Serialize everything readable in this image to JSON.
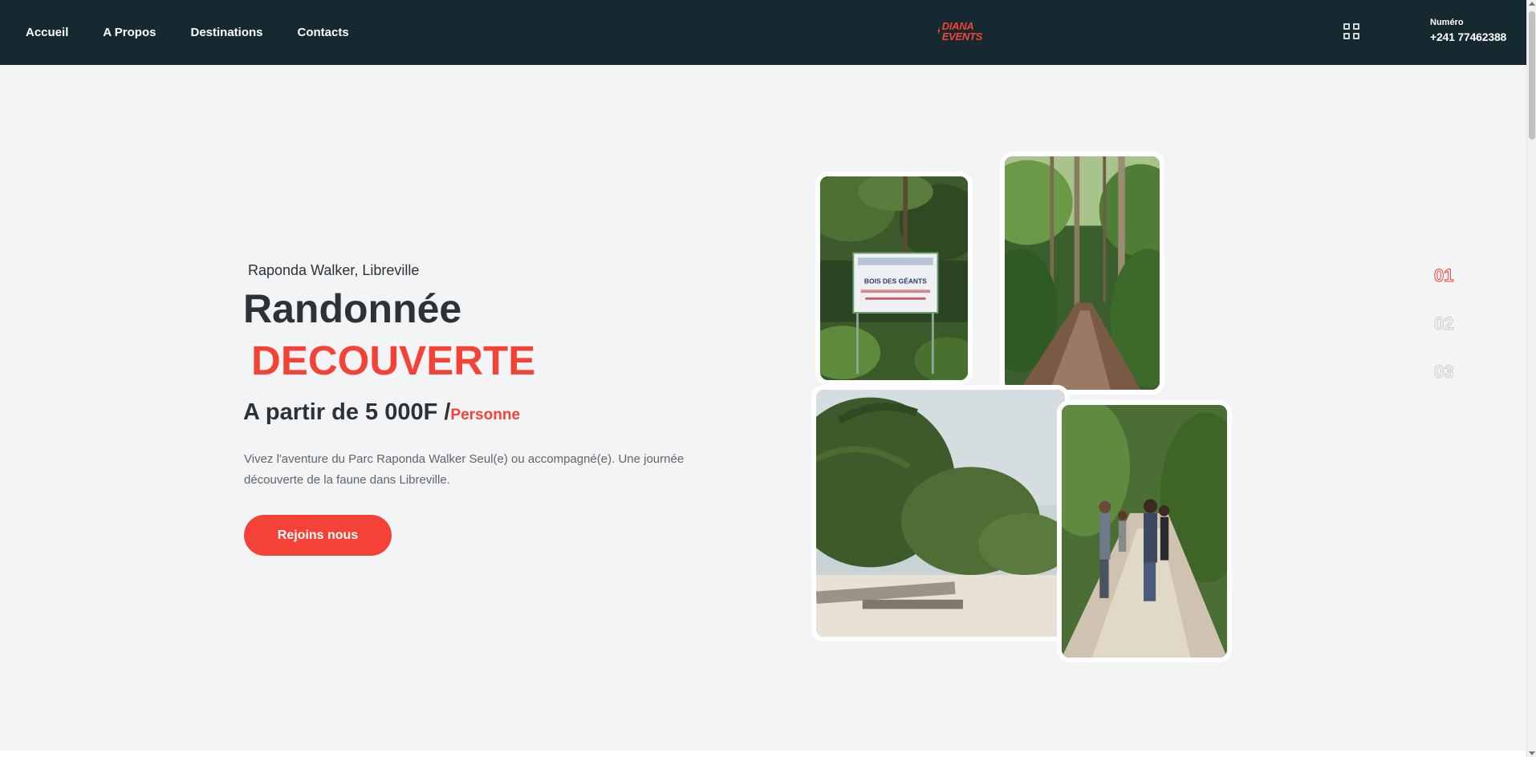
{
  "nav": {
    "items": [
      {
        "label": "Accueil"
      },
      {
        "label": "A Propos"
      },
      {
        "label": "Destinations"
      },
      {
        "label": "Contacts"
      }
    ]
  },
  "logo": {
    "line1": "DIANA",
    "line2": "EVENTS",
    "icon": "lightning-bolt-icon"
  },
  "header_right": {
    "menu_icon": "grid-icon",
    "contact_label": "Numéro",
    "contact_number": "+241 77462388"
  },
  "hero": {
    "location": "Raponda Walker, Libreville",
    "title_line1": "Randonnée",
    "title_line2": "DECOUVERTE",
    "price_text": "A partir de 5 000F /",
    "price_unit": "Personne",
    "description": "Vivez l'aventure du Parc Raponda Walker Seul(e) ou accompagné(e). Une journée découverte de la faune dans Libreville.",
    "cta_label": "Rejoins nous"
  },
  "gallery": {
    "photos": [
      {
        "subject": "forest sign",
        "sign_text": "BOIS DES GÉANTS"
      },
      {
        "subject": "forest trail"
      },
      {
        "subject": "palm beach"
      },
      {
        "subject": "hikers on trail"
      }
    ]
  },
  "slides": {
    "numbers": [
      "01",
      "02",
      "03"
    ],
    "active_index": 0
  },
  "colors": {
    "header_bg": "#172930",
    "accent": "#f44336",
    "text_dark": "#2b3338",
    "page_bg": "#f3f4f6"
  }
}
